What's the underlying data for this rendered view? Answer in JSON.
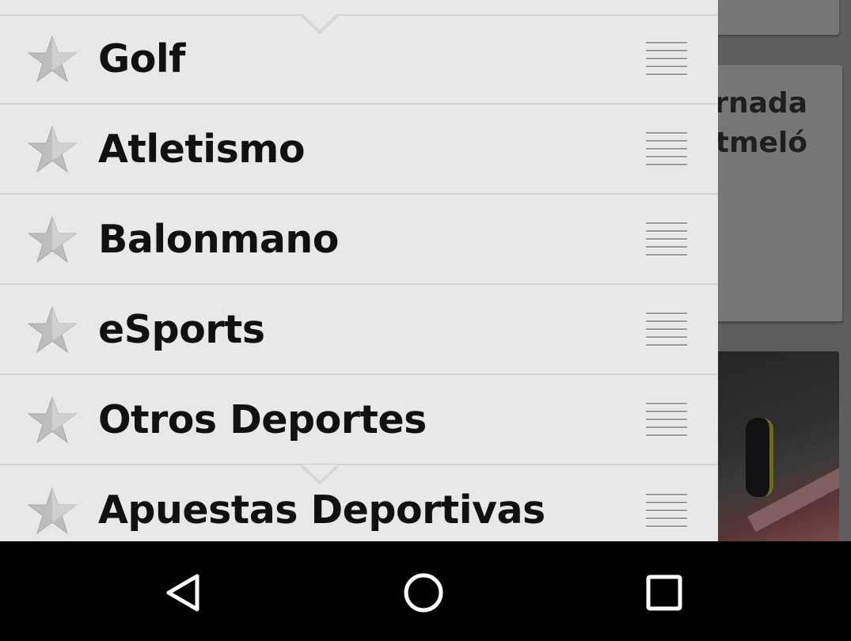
{
  "background": {
    "headline_fragment": "rnada\nntmeló"
  },
  "drawer": {
    "items": [
      {
        "label": "Golf",
        "star_icon": "star-icon",
        "handle_icon": "drag-handle-icon"
      },
      {
        "label": "Atletismo",
        "star_icon": "star-icon",
        "handle_icon": "drag-handle-icon"
      },
      {
        "label": "Balonmano",
        "star_icon": "star-icon",
        "handle_icon": "drag-handle-icon"
      },
      {
        "label": "eSports",
        "star_icon": "star-icon",
        "handle_icon": "drag-handle-icon"
      },
      {
        "label": "Otros Deportes",
        "star_icon": "star-icon",
        "handle_icon": "drag-handle-icon"
      },
      {
        "label": "Apuestas Deportivas",
        "star_icon": "star-icon",
        "handle_icon": "drag-handle-icon"
      }
    ]
  },
  "navbar": {
    "back_icon": "back-triangle-icon",
    "home_icon": "home-circle-icon",
    "recents_icon": "recents-square-icon"
  },
  "colors": {
    "drawer_bg": "#e8e8e8",
    "label_text": "#111111",
    "star": "#bdbdbd",
    "navbar_bg": "#000000",
    "scrim": "#5e5e5e"
  }
}
